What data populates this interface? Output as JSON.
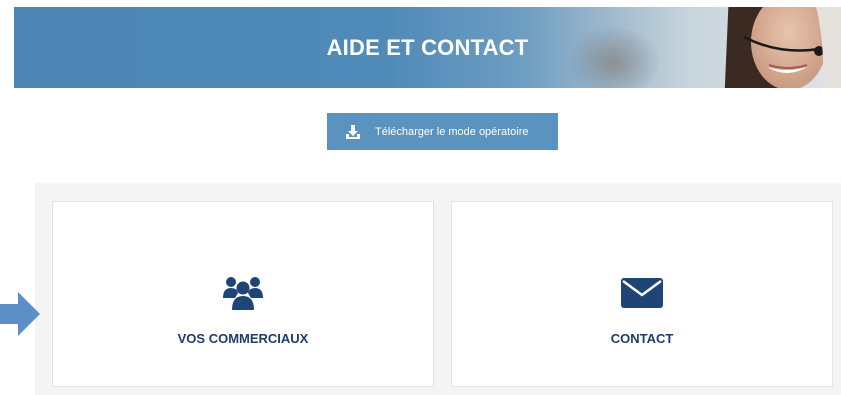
{
  "banner": {
    "title": "AIDE ET CONTACT"
  },
  "download": {
    "label": "Télécharger le mode opératoire",
    "icon": "download-icon"
  },
  "cards": [
    {
      "label": "VOS COMMERCIAUX",
      "icon": "users-icon"
    },
    {
      "label": "CONTACT",
      "icon": "envelope-icon"
    }
  ],
  "colors": {
    "banner_blue": "#4f8ab8",
    "button_blue": "#5b93c0",
    "label_navy": "#1d3d6b",
    "icon_navy": "#1f4577",
    "arrow_blue": "#5c8fc6"
  }
}
